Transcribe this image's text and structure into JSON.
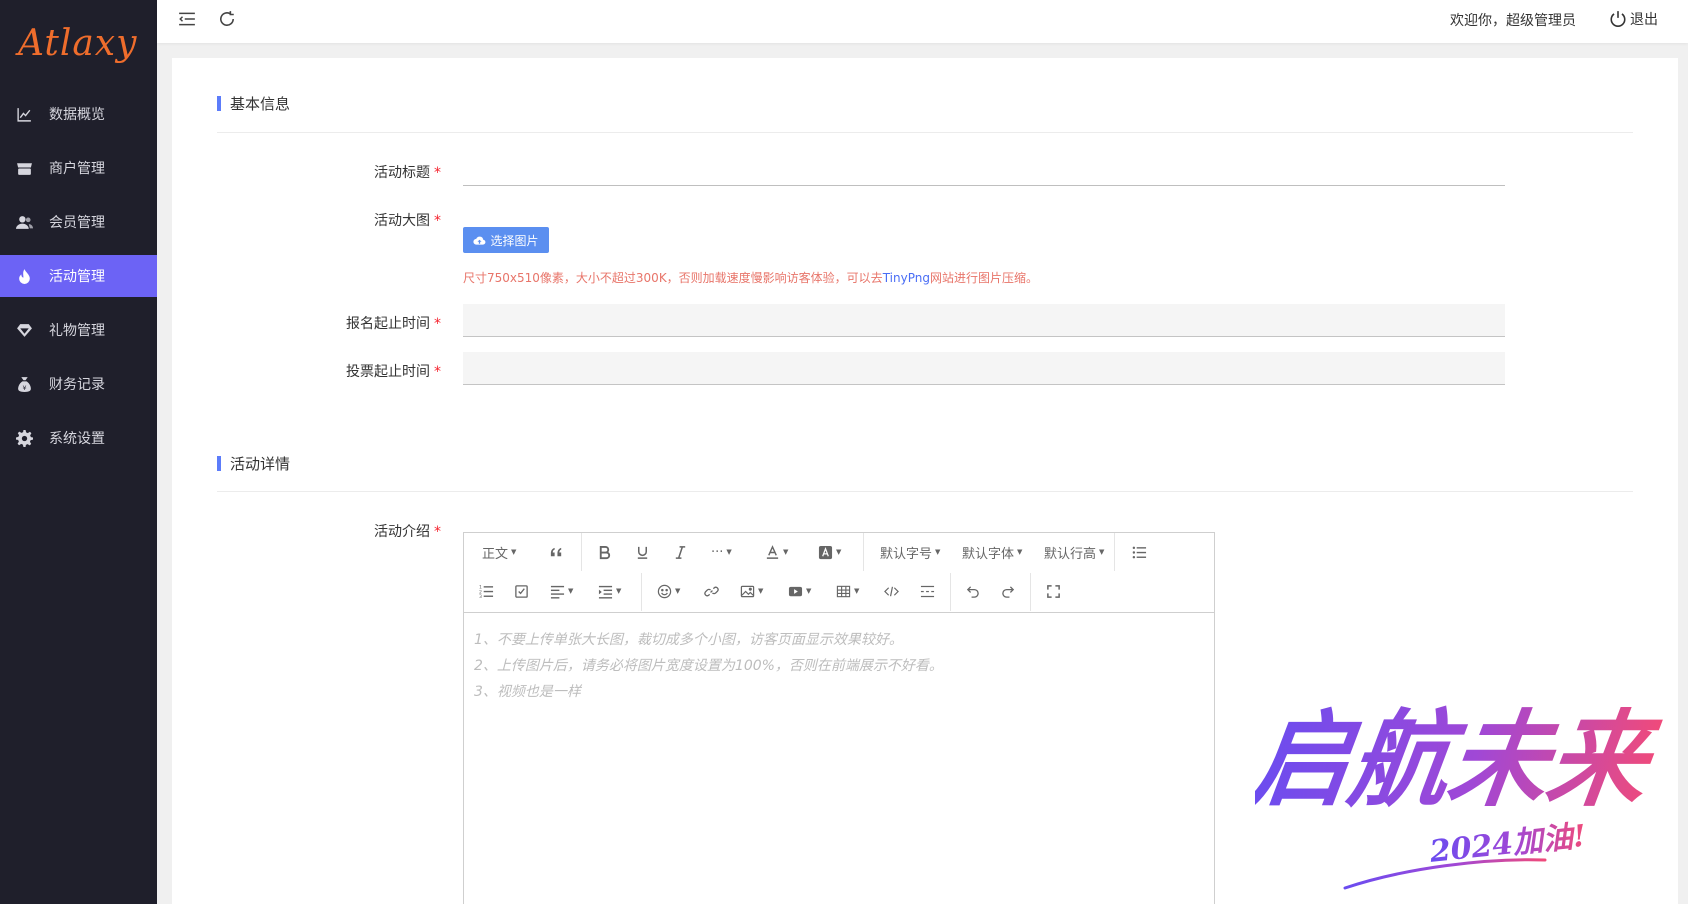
{
  "app": {
    "logo": "Atlaxy"
  },
  "sidebar": {
    "items": [
      {
        "label": "数据概览",
        "icon": "chart-line-icon"
      },
      {
        "label": "商户管理",
        "icon": "store-icon"
      },
      {
        "label": "会员管理",
        "icon": "users-icon"
      },
      {
        "label": "活动管理",
        "icon": "fire-icon",
        "active": true
      },
      {
        "label": "礼物管理",
        "icon": "diamond-icon"
      },
      {
        "label": "财务记录",
        "icon": "money-bag-icon"
      },
      {
        "label": "系统设置",
        "icon": "gear-icon"
      }
    ]
  },
  "topbar": {
    "welcome": "欢迎你，超级管理员",
    "logout": "退出"
  },
  "colors": {
    "accent": "#6c63f5",
    "sidebar_bg": "#1f1f2b",
    "logo": "#ef6d2c",
    "required": "#f5222d",
    "hint": "#e8756a",
    "link": "#4a6ef5",
    "button": "#5b8ff0"
  },
  "basic": {
    "title": "基本信息",
    "fields": {
      "title_label": "活动标题",
      "image_label": "活动大图",
      "signup_label": "报名起止时间",
      "vote_label": "投票起止时间"
    },
    "upload_button": "选择图片",
    "hint_before": "尺寸750x510像素，大小不超过300K，否则加载速度慢影响访客体验，可以去",
    "hint_link": "TinyPng",
    "hint_after": "网站进行图片压缩。",
    "required_mark": "*"
  },
  "detail": {
    "title": "活动详情",
    "intro_label": "活动介绍",
    "toolbar": {
      "paragraph": "正文",
      "font_size": "默认字号",
      "font_family": "默认字体",
      "line_height": "默认行高"
    },
    "placeholder_lines": [
      "1、不要上传单张大长图，裁切成多个小图，访客页面显示效果较好。",
      "2、上传图片后，请务必将图片宽度设置为100%，否则在前端展示不好看。",
      "3、视频也是一样"
    ]
  },
  "watermark": {
    "main": "启航未来",
    "sub": "2024加油!"
  }
}
